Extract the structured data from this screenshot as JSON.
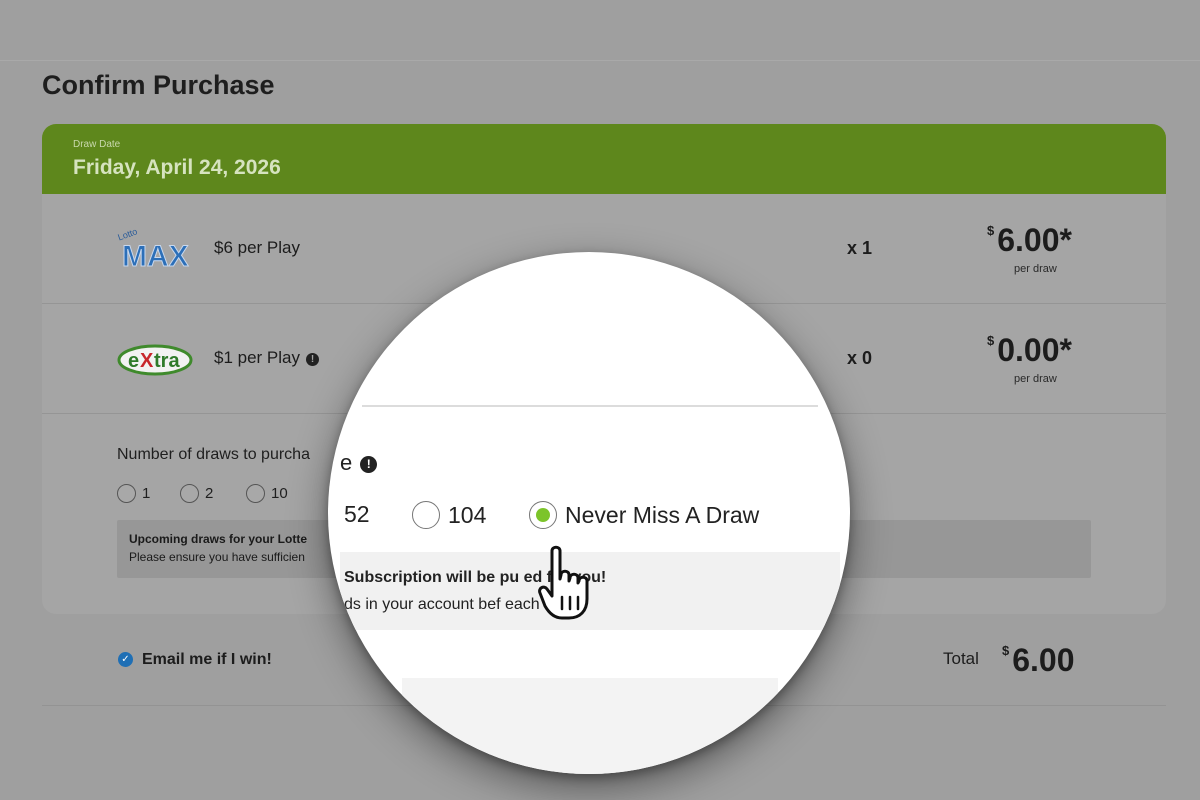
{
  "page": {
    "title": "Confirm Purchase"
  },
  "draw": {
    "label": "Draw Date",
    "date": "Friday, April 24, 2026"
  },
  "games": [
    {
      "name": "Lotto Max",
      "logo_icon": "lotto-max-logo",
      "play_label": "$6 per Play",
      "has_info": false,
      "quantity": "x 1",
      "price": "6.00*",
      "currency": "$",
      "per_draw": "per draw"
    },
    {
      "name": "Extra",
      "logo_icon": "extra-logo",
      "play_label": "$1 per Play",
      "has_info": true,
      "quantity": "x 0",
      "price": "0.00*",
      "currency": "$",
      "per_draw": "per draw"
    }
  ],
  "draws": {
    "title": "Number of draws to purcha",
    "options": [
      "1",
      "2",
      "10"
    ],
    "notice_title": "Upcoming draws for your Lotte",
    "notice_text": "Please ensure you have sufficien"
  },
  "magnified": {
    "title_fragment": "e",
    "options": [
      {
        "label": "52",
        "has_circle": false,
        "selected": false
      },
      {
        "label": "104",
        "has_circle": true,
        "selected": false
      },
      {
        "label": "Never Miss A Draw",
        "has_circle": true,
        "selected": true
      }
    ],
    "notice_title": "Subscription will be pu      ed for you!",
    "notice_text": "ds in your account bef    each draw.",
    "accent_color": "#7cc42a"
  },
  "footer": {
    "email_label": "Email me if I win!",
    "email_checked": true,
    "total_label": "Total",
    "total_currency": "$",
    "total_value": "6.00"
  },
  "colors": {
    "header_green": "#5e871c",
    "check_blue": "#1f6fb5",
    "selected_green": "#7cc42a"
  }
}
